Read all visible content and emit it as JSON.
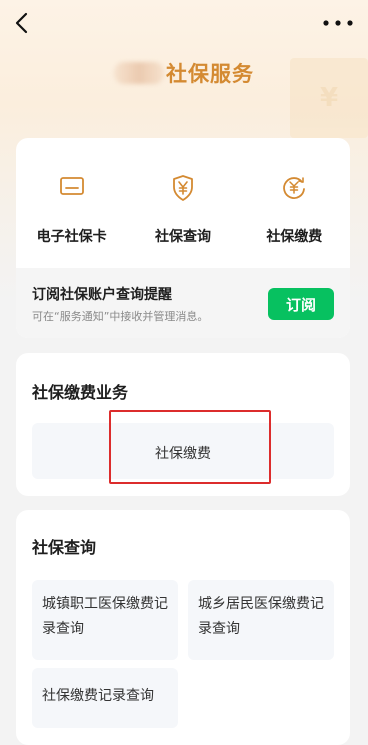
{
  "nav": {
    "back_icon": "chevron-left-icon",
    "more_icon": "more-dots-icon"
  },
  "header": {
    "title": "社保服务"
  },
  "services": [
    {
      "label": "电子社保卡",
      "icon": "social-security-card-icon"
    },
    {
      "label": "社保查询",
      "icon": "yuan-shield-icon"
    },
    {
      "label": "社保缴费",
      "icon": "yuan-refresh-icon"
    }
  ],
  "subscribe": {
    "title": "订阅社保账户查询提醒",
    "description": "可在“服务通知”中接收并管理消息。",
    "button_label": "订阅"
  },
  "payment_section": {
    "title": "社保缴费业务",
    "tile_label": "社保缴费"
  },
  "query_section": {
    "title": "社保查询",
    "tiles": [
      {
        "label": "城镇职工医保缴费记录查询"
      },
      {
        "label": "城乡居民医保缴费记录查询"
      },
      {
        "label": "社保缴费记录查询"
      }
    ]
  },
  "colors": {
    "accent": "#d48a32",
    "primary_button": "#07c160",
    "highlight": "#dc2c2c"
  }
}
